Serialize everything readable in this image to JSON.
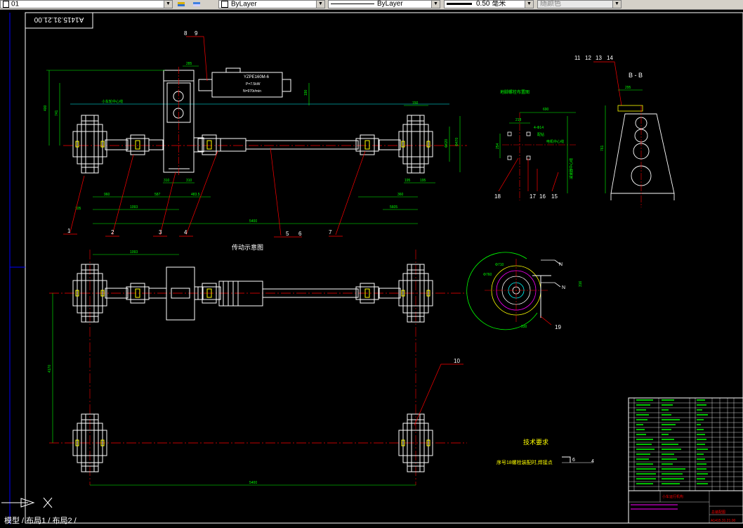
{
  "toolbar": {
    "layer_value": "01",
    "color_value": "ByLayer",
    "linetype_value": "ByLayer",
    "lineweight_value": "0.50 毫米",
    "plotstyle_value": "随颜色"
  },
  "drawing": {
    "drawing_number_box": "A1415.31.21.00",
    "title_main": "传动示意图",
    "title_bb": "B - B",
    "base_plan_title": "地脚螺栓布置图",
    "motor_model": "YZPE160M-6",
    "motor_power": "P=7.5kW",
    "motor_speed": "N=970r/min",
    "motor_axis_label": "电机中心线",
    "wheel_center_label": "小车轮中心线",
    "bolt_label": "4-Φ14",
    "bolt_sub": "配钻",
    "vertical_label": "减速器中心线",
    "tech_req_title": "技术要求",
    "tech_req_text": "序号18螺栓装配时,焊接点",
    "weld_symbol_a": "6",
    "weld_symbol_b": "4",
    "weld_n1": "N",
    "weld_n2": "N",
    "title_block_name": "小车运行机构",
    "title_block_part": "总装配图",
    "title_block_drawing_no": "A1415.31.21.00",
    "callouts": [
      "1",
      "2",
      "3",
      "4",
      "5",
      "6",
      "7",
      "8",
      "9",
      "10",
      "11",
      "12",
      "13",
      "14",
      "15",
      "16",
      "17",
      "18",
      "19"
    ],
    "dims": {
      "d285": "285",
      "d400": "400",
      "d741": "741",
      "d960": "960",
      "d1093": "1093",
      "d587": "587",
      "d310a": "310",
      "d310b": "310",
      "d483": "483.5",
      "d5400a": "5400",
      "d190": "190",
      "d150": "150",
      "d620": "Φ620",
      "d470": "Φ470",
      "d195a": "195",
      "d195b": "195",
      "d360": "360",
      "d5605": "5605",
      "d1093b": "1093",
      "d4170": "4170",
      "d5400b": "5400",
      "d690": "690",
      "d218": "218",
      "d254": "254",
      "d295": "295",
      "d761": "761",
      "d710": "Φ710",
      "d760": "Φ760",
      "d330": "330",
      "d316": "316",
      "d105": "105"
    }
  },
  "layout_tabs": "模型 / 布局1 / 布局2 /",
  "colors": {
    "background": "#000000",
    "white_lines": "#ffffff",
    "green_dims": "#00ff00",
    "red_leaders": "#ff0000",
    "cyan": "#00ffff",
    "yellow": "#ffff00",
    "magenta": "#ff00ff",
    "blue": "#0000ff"
  }
}
